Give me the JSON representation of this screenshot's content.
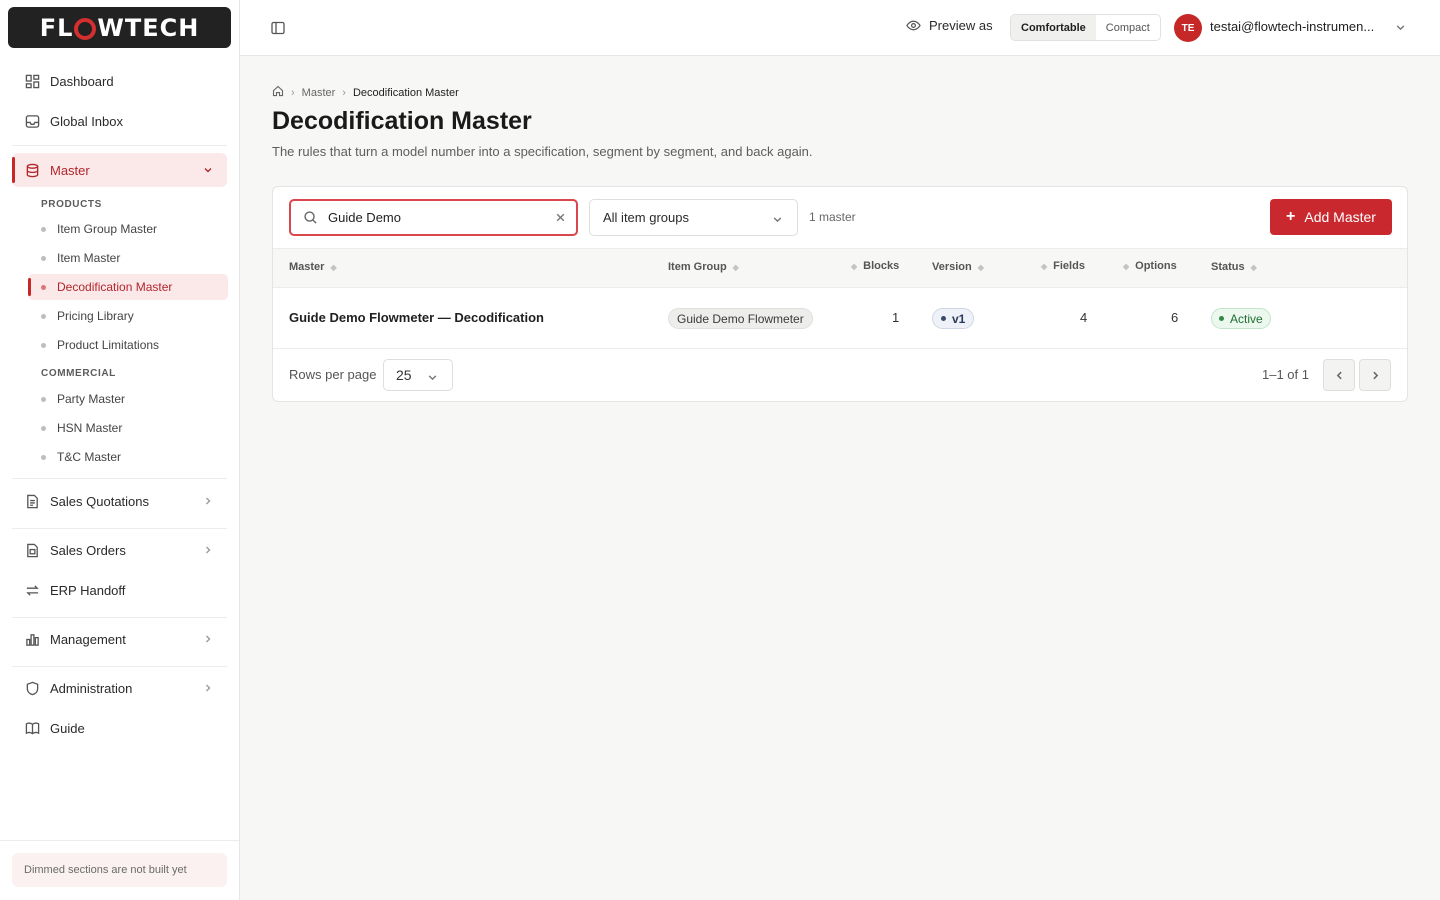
{
  "brand": {
    "logo_pre": "FL",
    "logo_post": "WTECH"
  },
  "sidebar": {
    "dashboard": "Dashboard",
    "global_inbox": "Global Inbox",
    "master": "Master",
    "products_heading": "PRODUCTS",
    "products": [
      "Item Group Master",
      "Item Master",
      "Decodification Master",
      "Pricing Library",
      "Product Limitations"
    ],
    "commercial_heading": "COMMERCIAL",
    "commercial": [
      "Party Master",
      "HSN Master",
      "T&C Master"
    ],
    "sales_quotations": "Sales Quotations",
    "sales_orders": "Sales Orders",
    "erp_handoff": "ERP Handoff",
    "management": "Management",
    "administration": "Administration",
    "guide": "Guide",
    "footer_note": "Dimmed sections are not built yet"
  },
  "topbar": {
    "preview_as": "Preview as",
    "density_comfortable": "Comfortable",
    "density_compact": "Compact",
    "avatar_initials": "TE",
    "user_email": "testai@flowtech-instrumen..."
  },
  "breadcrumb": {
    "parent": "Master",
    "current": "Decodification Master"
  },
  "page": {
    "title": "Decodification Master",
    "subtitle": "The rules that turn a model number into a specification, segment by segment, and back again."
  },
  "toolbar": {
    "search_value": "Guide Demo",
    "item_group_filter": "All item groups",
    "count": "1 master",
    "add_label": "Add Master"
  },
  "table": {
    "headers": {
      "master": "Master",
      "item_group": "Item Group",
      "blocks": "Blocks",
      "version": "Version",
      "fields": "Fields",
      "options": "Options",
      "status": "Status"
    },
    "rows": [
      {
        "master": "Guide Demo Flowmeter — Decodification",
        "item_group": "Guide Demo Flowmeter",
        "blocks": "1",
        "version": "v1",
        "fields": "4",
        "options": "6",
        "status": "Active"
      }
    ]
  },
  "pagination": {
    "rows_per_page_label": "Rows per page",
    "rows_per_page": "25",
    "range": "1–1 of 1"
  }
}
